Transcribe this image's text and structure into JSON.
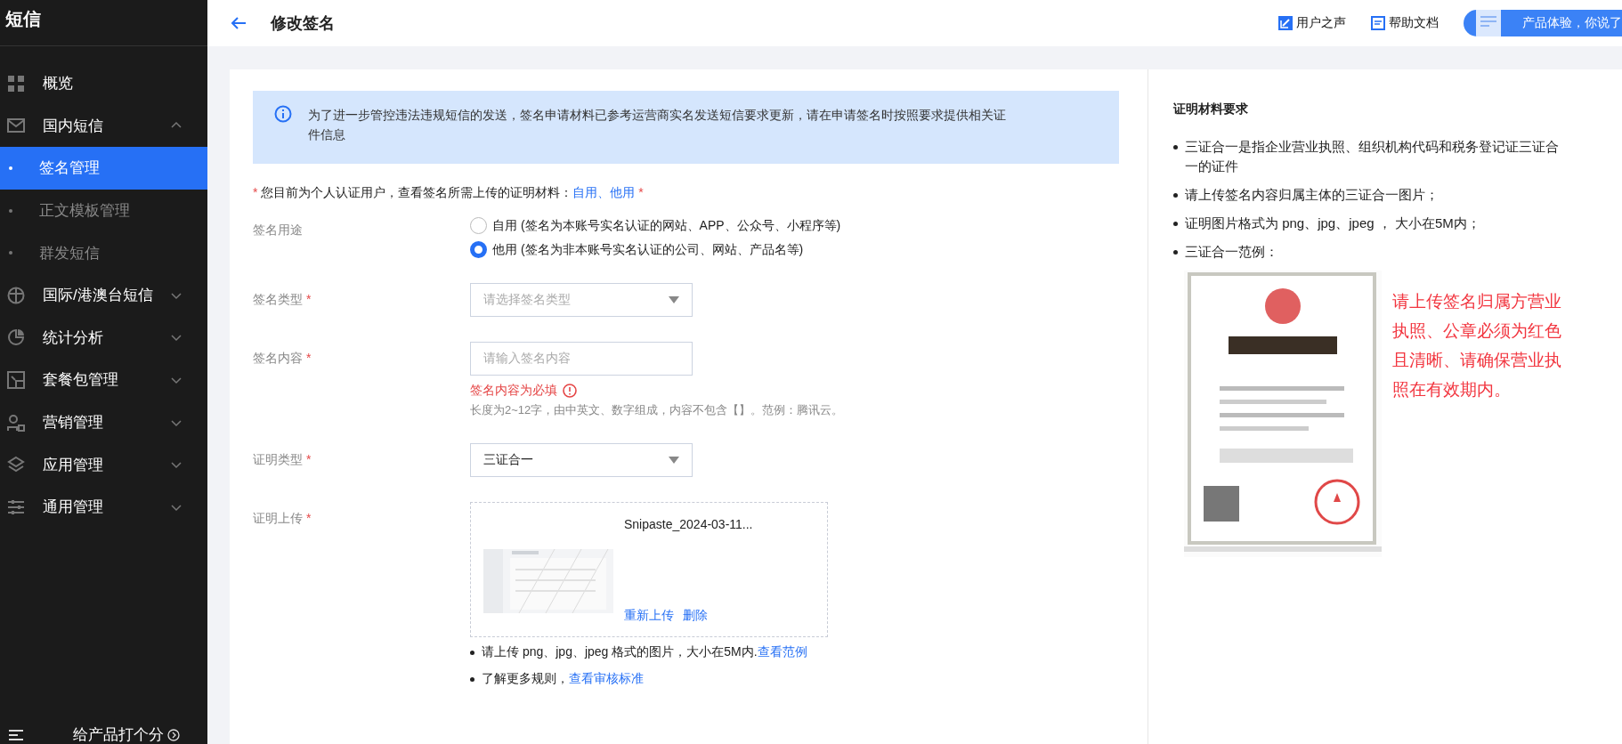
{
  "sidebar": {
    "title": "短信",
    "items": [
      {
        "label": "概览",
        "selected": false
      },
      {
        "label": "国内短信",
        "expanded": true,
        "selected": false,
        "children": [
          {
            "label": "签名管理",
            "selected": true
          },
          {
            "label": "正文模板管理",
            "selected": false
          },
          {
            "label": "群发短信",
            "selected": false
          }
        ]
      },
      {
        "label": "国际/港澳台短信",
        "expanded": false,
        "selected": false
      },
      {
        "label": "统计分析",
        "expanded": false,
        "selected": false
      },
      {
        "label": "套餐包管理",
        "expanded": false,
        "selected": false
      },
      {
        "label": "营销管理",
        "expanded": false,
        "selected": false
      },
      {
        "label": "应用管理",
        "expanded": false,
        "selected": false
      },
      {
        "label": "通用管理",
        "expanded": false,
        "selected": false
      }
    ],
    "footer": "给产品打个分"
  },
  "header": {
    "title": "修改签名",
    "links": [
      "用户之声",
      "帮助文档"
    ],
    "feedback": "产品体验，你说了"
  },
  "notice": "为了进一步管控违法违规短信的发送，签名申请材料已参考运营商实名发送短信要求更新，请在申请签名时按照要求提供相关证件信息",
  "intro": {
    "mark": "*",
    "text": "您目前为个人认证用户，查看签名所需上传的证明材料：",
    "links": [
      "自用",
      "他用"
    ],
    "separator": "、",
    "end_mark": "*"
  },
  "form": [
    {
      "kind": "radio",
      "label": "签名用途",
      "options": [
        {
          "label": "自用",
          "note": "(签名为本账号实名认证的网站、APP、公众号、小程序等)",
          "selected": false
        },
        {
          "label": "他用",
          "note": "(签名为非本账号实名认证的公司、网站、产品名等)",
          "selected": true
        }
      ]
    },
    {
      "kind": "select",
      "label": "签名类型",
      "required_mark": "*",
      "placeholder": "请选择签名类型"
    },
    {
      "kind": "input",
      "label": "签名内容",
      "required_mark": "*",
      "placeholder": "请输入签名内容",
      "error": "签名内容为必填",
      "hint": "长度为2~12字，由中英文、数字组成，内容不包含【】。范例：腾讯云。"
    },
    {
      "kind": "select",
      "label": "证明类型",
      "required_mark": "*",
      "value": "三证合一"
    },
    {
      "kind": "upload",
      "label": "证明上传",
      "required_mark": "*",
      "file": "Snipaste_2024-03-11...",
      "actions": [
        "重新上传",
        "删除"
      ],
      "tips": [
        {
          "text": "请上传 png、jpg、jpeg 格式的图片，大小在5M内.",
          "link": "查看范例"
        },
        {
          "text": "了解更多规则，",
          "link": "查看审核标准"
        }
      ]
    }
  ],
  "requirements": {
    "title": "证明材料要求",
    "items": [
      "三证合一是指企业营业执照、组织机构代码和税务登记证三证合一的证件",
      "请上传签名内容归属主体的三证合一图片；",
      "证明图片格式为 png、jpg、jpeg ， 大小在5M内；",
      "三证合一范例："
    ],
    "example": {
      "kind": "picture",
      "caption": "请上传签名归属方营业执照、公章必须为红色且清晰、请确保营业执照在有效期内。"
    }
  }
}
